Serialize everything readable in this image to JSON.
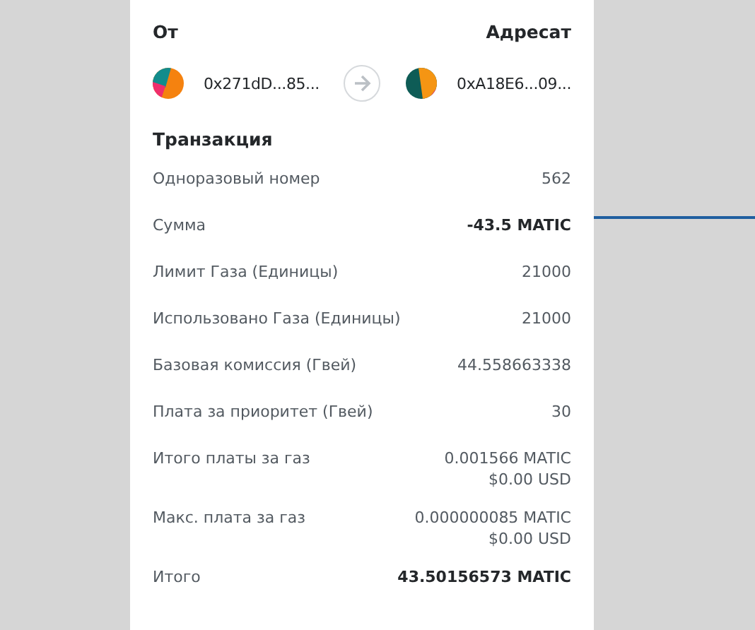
{
  "from": {
    "label": "От",
    "address": "0x271dD...85..."
  },
  "to": {
    "label": "Адресат",
    "address": "0xA18E6...09..."
  },
  "section_title": "Транзакция",
  "rows": [
    {
      "label": "Одноразовый номер",
      "values": [
        "562"
      ],
      "bold": false
    },
    {
      "label": "Сумма",
      "values": [
        "-43.5 MATIC"
      ],
      "bold": true
    },
    {
      "label": "Лимит Газа (Единицы)",
      "values": [
        "21000"
      ],
      "bold": false
    },
    {
      "label": "Использовано Газа (Единицы)",
      "values": [
        "21000"
      ],
      "bold": false
    },
    {
      "label": "Базовая комиссия (Гвей)",
      "values": [
        "44.558663338"
      ],
      "bold": false
    },
    {
      "label": "Плата за приоритет (Гвей)",
      "values": [
        "30"
      ],
      "bold": false
    },
    {
      "label": "Итого платы за газ",
      "values": [
        "0.001566 MATIC",
        "$0.00 USD"
      ],
      "bold": false
    },
    {
      "label": "Макс. плата за газ",
      "values": [
        "0.000000085 MATIC",
        "$0.00 USD"
      ],
      "bold": false
    },
    {
      "label": "Итого",
      "values": [
        "43.50156573 MATIC"
      ],
      "bold": true
    }
  ]
}
